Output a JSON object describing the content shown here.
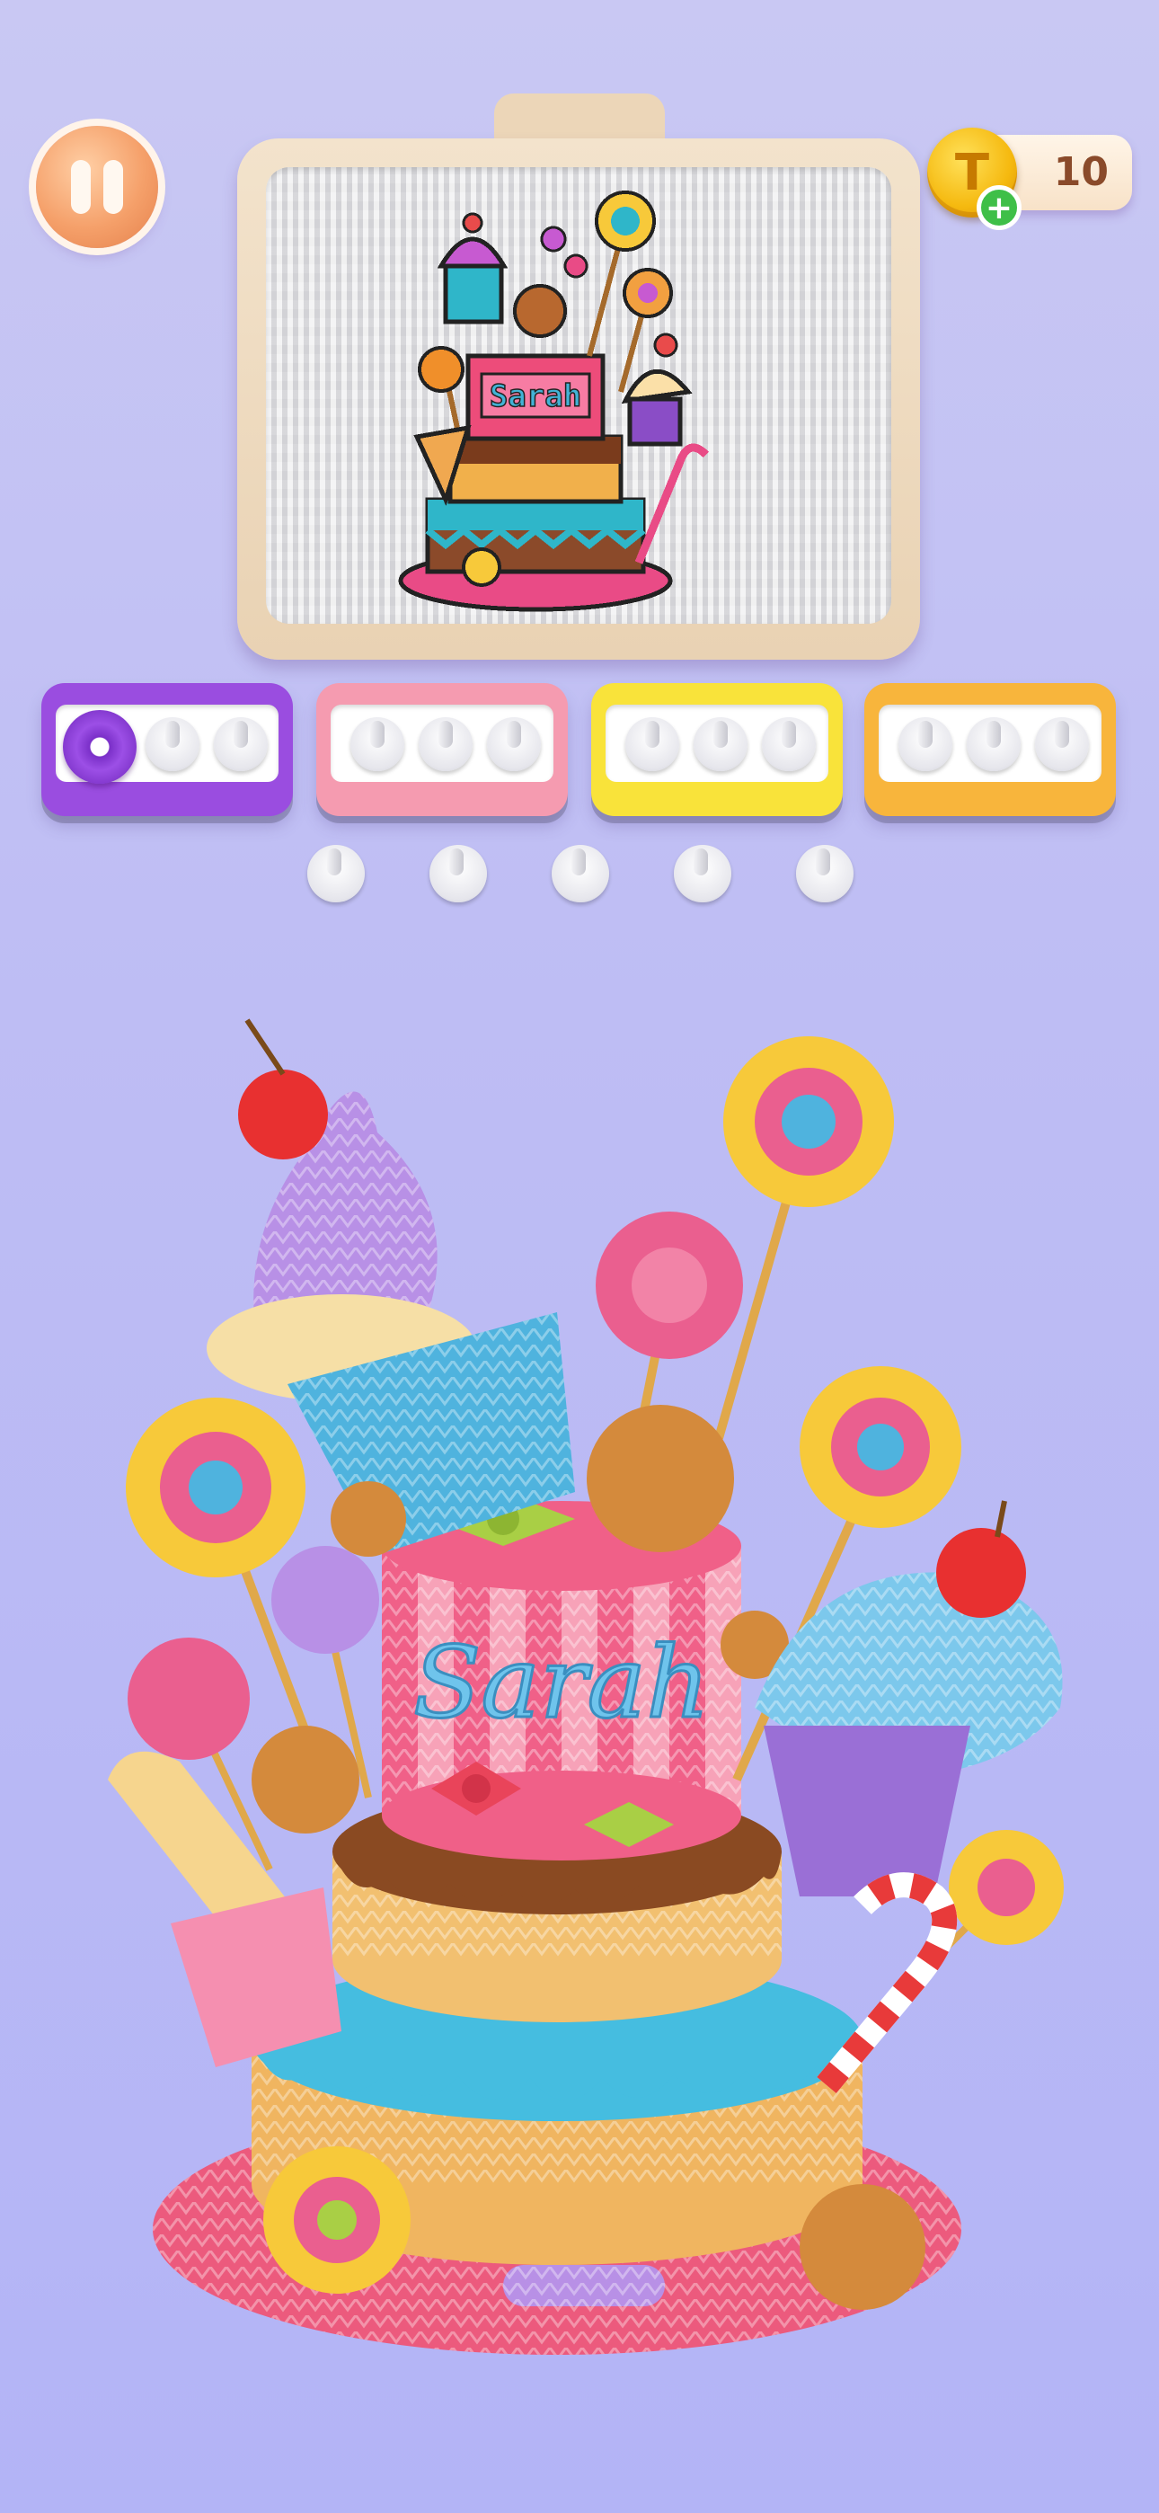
{
  "hud": {
    "pause_icon": "pause-icon",
    "coins": "10",
    "coin_icon": "coin-icon",
    "coin_add_icon": "plus-icon"
  },
  "pattern": {
    "name_text": "Sarah"
  },
  "trays": [
    {
      "color": "#9a4de0",
      "border": "#7c2fc6",
      "filled_slots": 1
    },
    {
      "color": "#f59bb0",
      "border": "#e67e98",
      "filled_slots": 0
    },
    {
      "color": "#f9e33a",
      "border": "#e3c516",
      "filled_slots": 0
    },
    {
      "color": "#f8b53c",
      "border": "#e69a1c",
      "filled_slots": 0
    }
  ],
  "spare_pegs": 5,
  "cake": {
    "name_text": "Sarah"
  }
}
